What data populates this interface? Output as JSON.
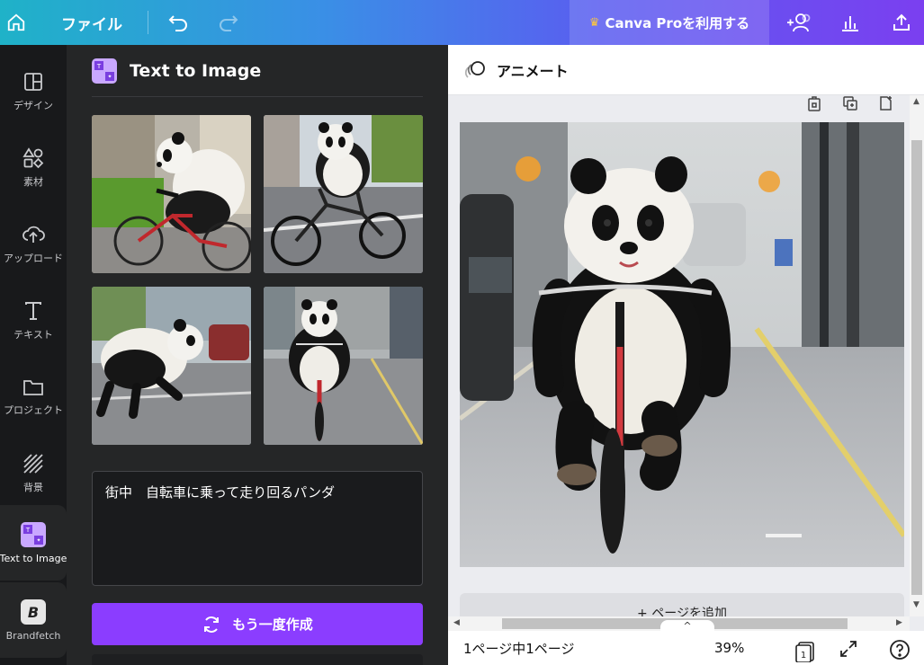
{
  "topbar": {
    "file_label": "ファイル",
    "pro_label": "Canva Proを利用する"
  },
  "rail": {
    "items": [
      {
        "label": "デザイン"
      },
      {
        "label": "素材"
      },
      {
        "label": "アップロード"
      },
      {
        "label": "テキスト"
      },
      {
        "label": "プロジェクト"
      },
      {
        "label": "背景"
      },
      {
        "label": "Text to Image"
      },
      {
        "label": "Brandfetch"
      }
    ]
  },
  "panel": {
    "title": "Text to Image",
    "prompt": "街中　自転車に乗って走り回るパンダ",
    "regenerate_label": "もう一度作成"
  },
  "canvas": {
    "animate_label": "アニメート",
    "add_page_label": "+ ページを追加",
    "page_info": "1ページ中1ページ",
    "zoom": "39%",
    "page_count_badge": "1"
  },
  "colors": {
    "accent": "#8b3dff",
    "panel_bg": "#252627",
    "rail_bg": "#18191b",
    "crown": "#ffc83d"
  }
}
